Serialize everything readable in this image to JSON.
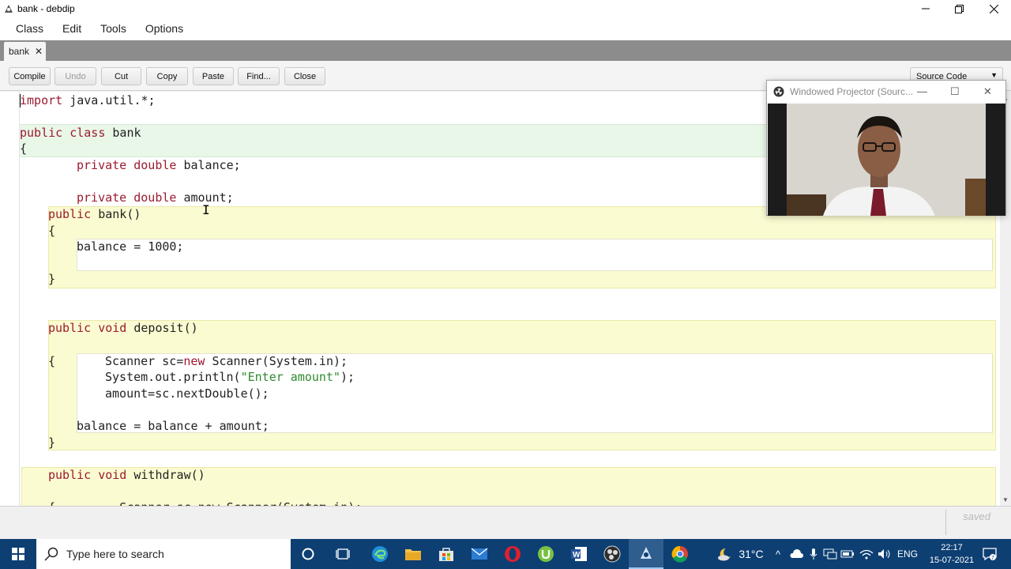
{
  "window": {
    "title": "bank - debdip"
  },
  "menu": [
    "Class",
    "Edit",
    "Tools",
    "Options"
  ],
  "tab": {
    "label": "bank",
    "close": "✕"
  },
  "toolbar": {
    "compile": "Compile",
    "undo": "Undo",
    "cut": "Cut",
    "copy": "Copy",
    "paste": "Paste",
    "find": "Find...",
    "close": "Close",
    "view_select": "Source Code"
  },
  "code": {
    "l1_kw": "import",
    "l1_rest": " java.util.*;",
    "l3_kw": "public class",
    "l3_rest": " bank",
    "l4": "{",
    "l5_kw": "private double",
    "l5_rest": " balance;",
    "l7_kw": "private double",
    "l7_rest": " amount;",
    "l8_kw": "public",
    "l8_rest": " bank()",
    "l9": "{",
    "l10": "balance = 1000;",
    "l12": "}",
    "l15_kw": "public void",
    "l15_rest": " deposit()",
    "l17a": "{",
    "l17_pre": "Scanner sc=",
    "l17_kw": "new",
    "l17_post": " Scanner(System.in);",
    "l18_pre": "System.out.println(",
    "l18_str": "\"Enter amount\"",
    "l18_post": ");",
    "l19": "amount=sc.nextDouble();",
    "l21": "balance = balance + amount;",
    "l22": "}",
    "l24_kw": "public void",
    "l24_rest": " withdraw()",
    "l26": "{         Scanner sc=new Scanner(System.in);"
  },
  "status": {
    "text": "saved"
  },
  "projector": {
    "title": "Windowed Projector (Sourc..."
  },
  "taskbar": {
    "search_placeholder": "Type here to search",
    "weather": "31°C",
    "language": "ENG",
    "time": "22:17",
    "date": "15-07-2021"
  },
  "colors": {
    "keyword": "#9c1a2e",
    "string": "#2e8b2e",
    "class_scope": "#e9f7e9",
    "method_scope": "#fbfbd2",
    "taskbar": "#0d3f73"
  }
}
